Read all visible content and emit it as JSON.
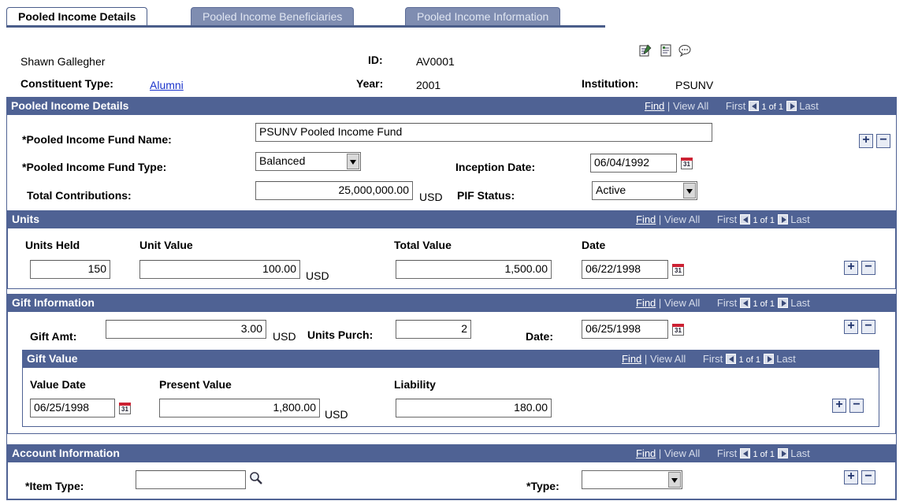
{
  "tabs": [
    {
      "label": "Pooled Income Details"
    },
    {
      "label": "Pooled Income Beneficiaries"
    },
    {
      "label": "Pooled Income Information"
    }
  ],
  "header": {
    "name": "Shawn Gallegher",
    "id_label": "ID:",
    "id_value": "AV0001",
    "constituent_type_label": "Constituent Type:",
    "constituent_type_value": "Alumni",
    "year_label": "Year:",
    "year_value": "2001",
    "institution_label": "Institution:",
    "institution_value": "PSUNV"
  },
  "nav": {
    "find": "Find",
    "sep": "|",
    "view_all": "View All",
    "first": "First",
    "count": "1 of 1",
    "last": "Last"
  },
  "details": {
    "title": "Pooled Income Details",
    "fund_name_label": "*Pooled Income Fund Name:",
    "fund_name_value": "PSUNV Pooled Income Fund",
    "fund_type_label": "*Pooled Income Fund Type:",
    "fund_type_value": "Balanced",
    "inception_label": "Inception Date:",
    "inception_value": "06/04/1992",
    "total_contrib_label": "Total Contributions:",
    "total_contrib_value": "25,000,000.00",
    "currency": "USD",
    "pif_status_label": "PIF Status:",
    "pif_status_value": "Active"
  },
  "units": {
    "title": "Units",
    "units_held_label": "Units Held",
    "unit_value_label": "Unit Value",
    "total_value_label": "Total Value",
    "date_label": "Date",
    "units_held": "150",
    "unit_value": "100.00",
    "currency": "USD",
    "total_value": "1,500.00",
    "date": "06/22/1998"
  },
  "gift": {
    "title": "Gift Information",
    "gift_amt_label": "Gift Amt:",
    "gift_amt": "3.00",
    "currency": "USD",
    "units_purch_label": "Units Purch:",
    "units_purch": "2",
    "date_label": "Date:",
    "date": "06/25/1998"
  },
  "gift_value": {
    "title": "Gift Value",
    "value_date_label": "Value Date",
    "present_value_label": "Present Value",
    "liability_label": "Liability",
    "value_date": "06/25/1998",
    "present_value": "1,800.00",
    "currency": "USD",
    "liability": "180.00"
  },
  "account": {
    "title": "Account Information",
    "item_type_label": "*Item Type:",
    "item_type_value": "",
    "type_label": "*Type:",
    "type_value": ""
  },
  "buttons": {
    "add": "+",
    "remove": "−"
  },
  "calendar_text": "31",
  "icons": [
    "notepad-icon",
    "report-icon",
    "comment-icon",
    "search-icon",
    "calendar-icon"
  ]
}
